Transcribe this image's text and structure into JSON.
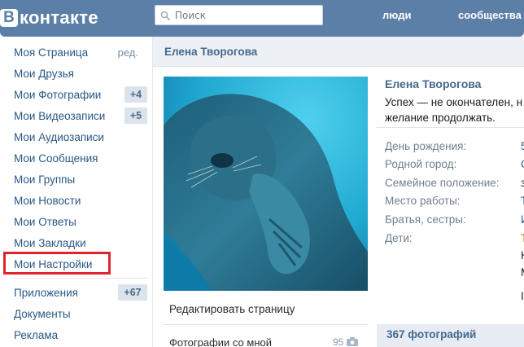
{
  "header": {
    "logo_letter": "В",
    "logo_text": "контакте",
    "search_placeholder": "Поиск",
    "nav": {
      "people": "люди",
      "communities": "сообщества"
    },
    "colors": {
      "header_bg": "#5b7fa6",
      "link": "#2a5885",
      "highlight_border": "#e0242b"
    }
  },
  "sidebar": {
    "items": [
      {
        "label": "Моя Страница",
        "extra": "ред."
      },
      {
        "label": "Мои Друзья"
      },
      {
        "label": "Мои Фотографии",
        "badge": "+4"
      },
      {
        "label": "Мои Видеозаписи",
        "badge": "+5"
      },
      {
        "label": "Мои Аудиозаписи"
      },
      {
        "label": "Мои Сообщения"
      },
      {
        "label": "Мои Группы"
      },
      {
        "label": "Мои Новости"
      },
      {
        "label": "Мои Ответы"
      },
      {
        "label": "Мои Закладки"
      },
      {
        "label": "Мои Настройки",
        "highlighted": true
      }
    ],
    "apps": [
      {
        "label": "Приложения",
        "badge": "+67"
      },
      {
        "label": "Документы"
      },
      {
        "label": "Реклама"
      }
    ]
  },
  "content": {
    "title": "Елена Творогова",
    "edit_page": "Редактировать страницу",
    "photos_with_me": "Фотографии со мной",
    "photos_with_me_count": "95",
    "profile": {
      "name": "Елена Творогова",
      "status_line1": "Успех — не окончателен, н",
      "status_line2": "желание продолжать.",
      "fields": [
        {
          "label": "День рождения:",
          "value": "5"
        },
        {
          "label": "Родной город:",
          "value": "С"
        },
        {
          "label": "Семейное положение:",
          "value": "з"
        },
        {
          "label": "Место работы:",
          "value": "Т"
        },
        {
          "label": "Братья, сестры:",
          "value": "И"
        },
        {
          "label": "Дети:",
          "value": "Т"
        }
      ],
      "children_extra": [
        "Н",
        "М",
        "I"
      ]
    },
    "photos_section_title": "367 фотографий"
  },
  "icons": {
    "search": "magnifier-icon",
    "camera": "camera-icon"
  }
}
